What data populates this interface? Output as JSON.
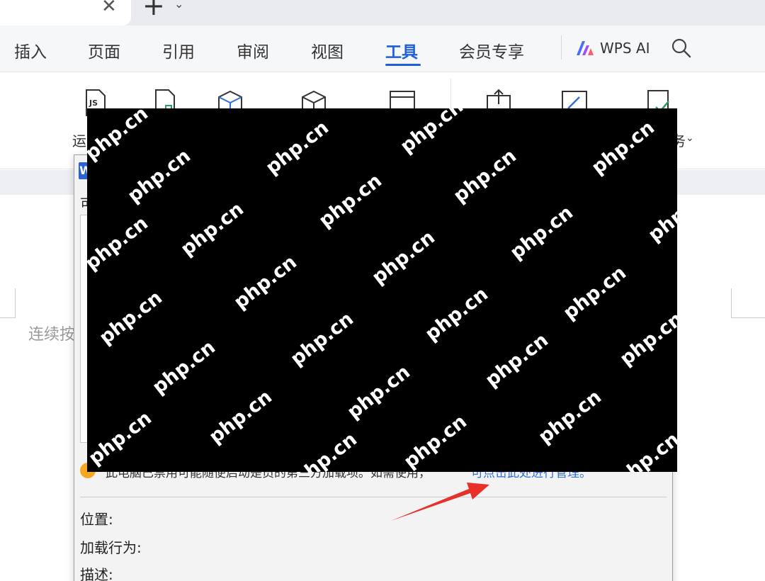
{
  "menu": {
    "items": [
      "插入",
      "页面",
      "引用",
      "审阅",
      "视图",
      "工具",
      "会员专享"
    ],
    "active": "工具",
    "ai_label": "WPS AI"
  },
  "ribbon": {
    "label_left": "运",
    "label_right": "务"
  },
  "document": {
    "text": "连续按"
  },
  "dialog": {
    "badge": "W",
    "list_label": "可",
    "warning_text": "此电脑已禁用可能随便启动是员的第三方加载项。如需使用，",
    "warning_link": "可点击此处进行管理。",
    "fields": {
      "location": "位置:",
      "load_behavior": "加载行为:",
      "description": "描述:"
    }
  },
  "watermark": {
    "text": "php.cn"
  },
  "colors": {
    "accent": "#1f5fd8",
    "warning": "#f5a623",
    "link": "#2f6fd6",
    "annotation_arrow": "#e8302a"
  },
  "icons": [
    "close-icon",
    "plus-icon",
    "chevron-down-icon",
    "wps-ai-logo-icon",
    "search-icon",
    "js-macro-icon",
    "document-lock-icon",
    "cube-icon",
    "cube-gear-icon",
    "window-code-icon",
    "export-icon",
    "edit-pen-icon",
    "form-check-icon",
    "warning-icon",
    "arrow-annotation-icon"
  ]
}
